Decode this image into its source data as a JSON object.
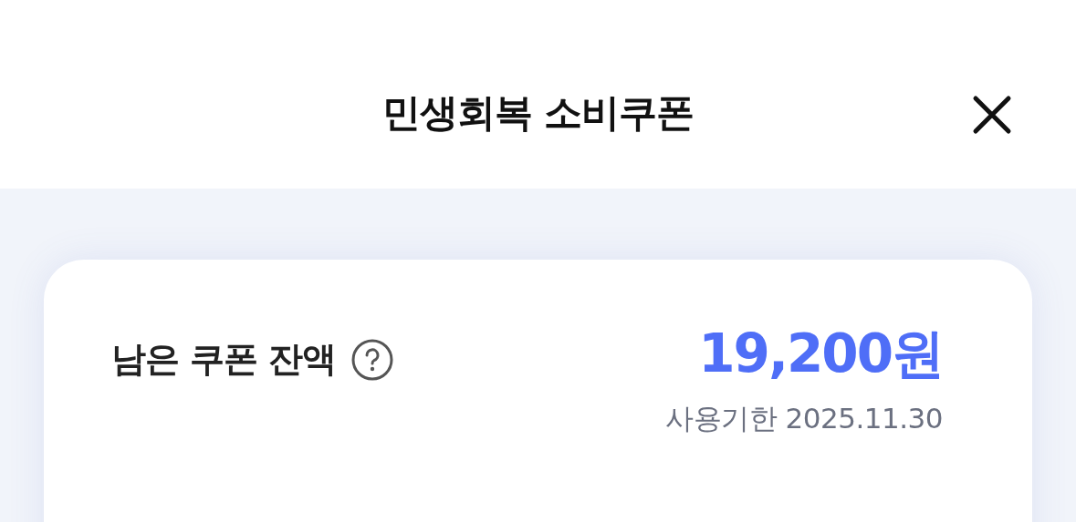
{
  "header": {
    "title": "민생회복 소비쿠폰"
  },
  "balance_card": {
    "label": "남은 쿠폰 잔액",
    "amount": "19,200원",
    "expiry": "사용기한 2025.11.30"
  }
}
